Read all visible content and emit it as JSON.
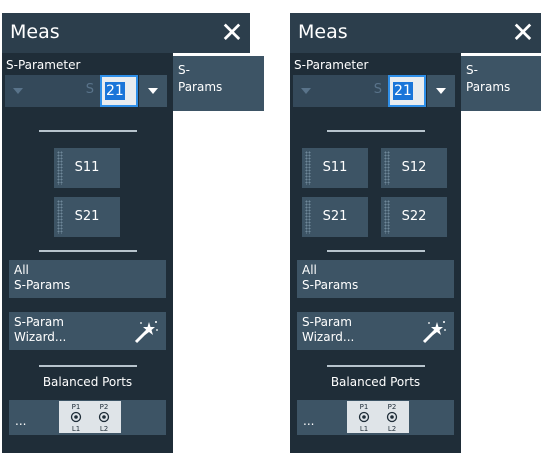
{
  "left_panel": {
    "title": "Meas",
    "section_label": "S-Parameter",
    "combo_prefix": "S",
    "combo_value": "21",
    "side_tab": {
      "line1": "S-",
      "line2": "Params"
    },
    "s_buttons": [
      "S11",
      "S21"
    ],
    "all_sparams": {
      "line1": "All",
      "line2": "S-Params"
    },
    "wizard": {
      "line1": "S-Param",
      "line2": "Wizard..."
    },
    "balanced_ports": "Balanced Ports",
    "ports_more": "...",
    "ports_icon": {
      "p1": "P1",
      "p2": "P2",
      "l1": "L1",
      "l2": "L2"
    }
  },
  "right_panel": {
    "title": "Meas",
    "section_label": "S-Parameter",
    "combo_prefix": "S",
    "combo_value": "21",
    "side_tab": {
      "line1": "S-",
      "line2": "Params"
    },
    "s_buttons": [
      "S11",
      "S12",
      "S21",
      "S22"
    ],
    "all_sparams": {
      "line1": "All",
      "line2": "S-Params"
    },
    "wizard": {
      "line1": "S-Param",
      "line2": "Wizard..."
    },
    "balanced_ports": "Balanced Ports",
    "ports_more": "...",
    "ports_icon": {
      "p1": "P1",
      "p2": "P2",
      "l1": "L1",
      "l2": "L2"
    }
  },
  "icons": {
    "close": "close-icon",
    "dropdown": "chevron-down-icon",
    "wizard": "magic-wand-icon",
    "ports": "balanced-ports-icon"
  },
  "colors": {
    "header": "#2c3e4c",
    "panel": "#1f2d38",
    "button": "#3d5465",
    "accent": "#2f8fe8",
    "selection": "#1a75d9"
  }
}
